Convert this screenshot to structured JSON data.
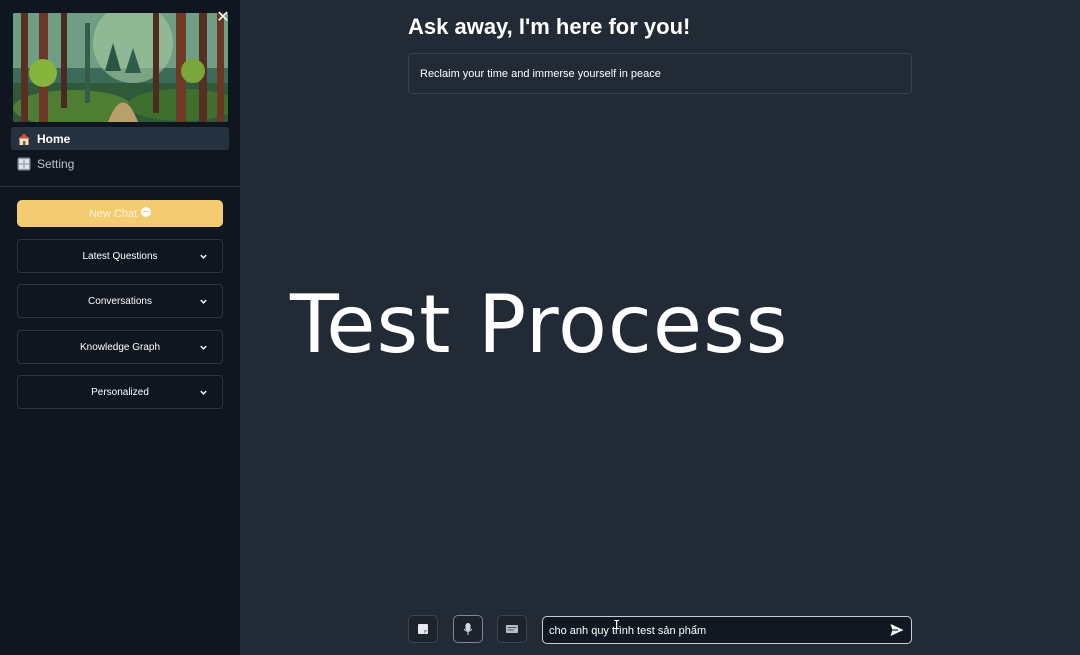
{
  "sidebar": {
    "hero_image": "forest-illustration",
    "close_icon": "close-icon",
    "nav": [
      {
        "label": "Home",
        "icon": "house-icon",
        "active": true
      },
      {
        "label": "Setting",
        "icon": "grid-icon",
        "active": false
      }
    ],
    "new_chat_label": "New Chat",
    "new_chat_icon": "chat-bubble-icon",
    "expanders": [
      {
        "label": "Latest Questions"
      },
      {
        "label": "Conversations"
      },
      {
        "label": "Knowledge Graph"
      },
      {
        "label": "Personalized"
      }
    ]
  },
  "main": {
    "title": "Ask away, I'm here for you!",
    "tagline": "Reclaim your time and immerse yourself in peace",
    "overlay_title": "Test Process",
    "tools": [
      {
        "icon": "note-icon"
      },
      {
        "icon": "microphone-icon"
      },
      {
        "icon": "document-icon"
      }
    ],
    "chat_input_value": "cho anh quy trình test sản phẩm",
    "send_icon": "send-icon"
  },
  "colors": {
    "sidebar_bg": "#10161f",
    "main_bg": "#212a35",
    "accent": "#f3cc72"
  }
}
